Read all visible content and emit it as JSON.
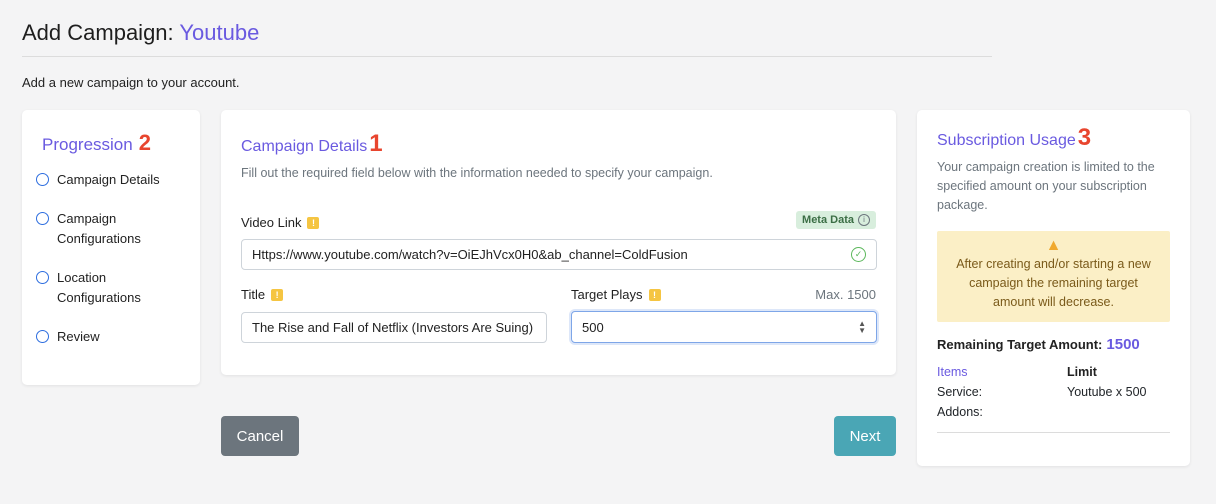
{
  "header": {
    "title_prefix": "Add Campaign:",
    "title_brand": "Youtube"
  },
  "subtitle": "Add a new campaign to your account.",
  "progression": {
    "title": "Progression",
    "number": "2",
    "items": [
      {
        "label": "Campaign Details"
      },
      {
        "label": "Campaign Configurations"
      },
      {
        "label": "Location Configurations"
      },
      {
        "label": "Review"
      }
    ]
  },
  "details": {
    "title": "Campaign Details",
    "number": "1",
    "description": "Fill out the required field below with the information needed to specify your campaign.",
    "video_link_label": "Video Link",
    "meta_badge": "Meta Data",
    "video_link_value": "Https://www.youtube.com/watch?v=OiEJhVcx0H0&ab_channel=ColdFusion",
    "title_label": "Title",
    "title_value": "The Rise and Fall of Netflix (Investors Are Suing)",
    "target_label": "Target Plays",
    "target_max": "Max. 1500",
    "target_value": "500",
    "warn_glyph": "!"
  },
  "subscription": {
    "title": "Subscription Usage",
    "number": "3",
    "description": "Your campaign creation is limited to the specified amount on your subscription package.",
    "alert_text": "After creating and/or starting a new campaign the remaining target amount will decrease.",
    "remaining_label": "Remaining Target Amount:",
    "remaining_value": "1500",
    "items_header": "Items",
    "limit_header": "Limit",
    "service_label": "Service:",
    "service_value": "Youtube x 500",
    "addons_label": "Addons:"
  },
  "buttons": {
    "cancel": "Cancel",
    "next": "Next"
  },
  "colors": {
    "accent": "#6a5ae0",
    "number_red": "#e8452e",
    "next_teal": "#4aa6b5",
    "cancel_gray": "#6c757d"
  },
  "icons": {
    "radio": "radio-circle",
    "warning": "warning-icon",
    "info": "info-icon",
    "check": "check-circle-icon",
    "alert": "warning-triangle-icon"
  }
}
